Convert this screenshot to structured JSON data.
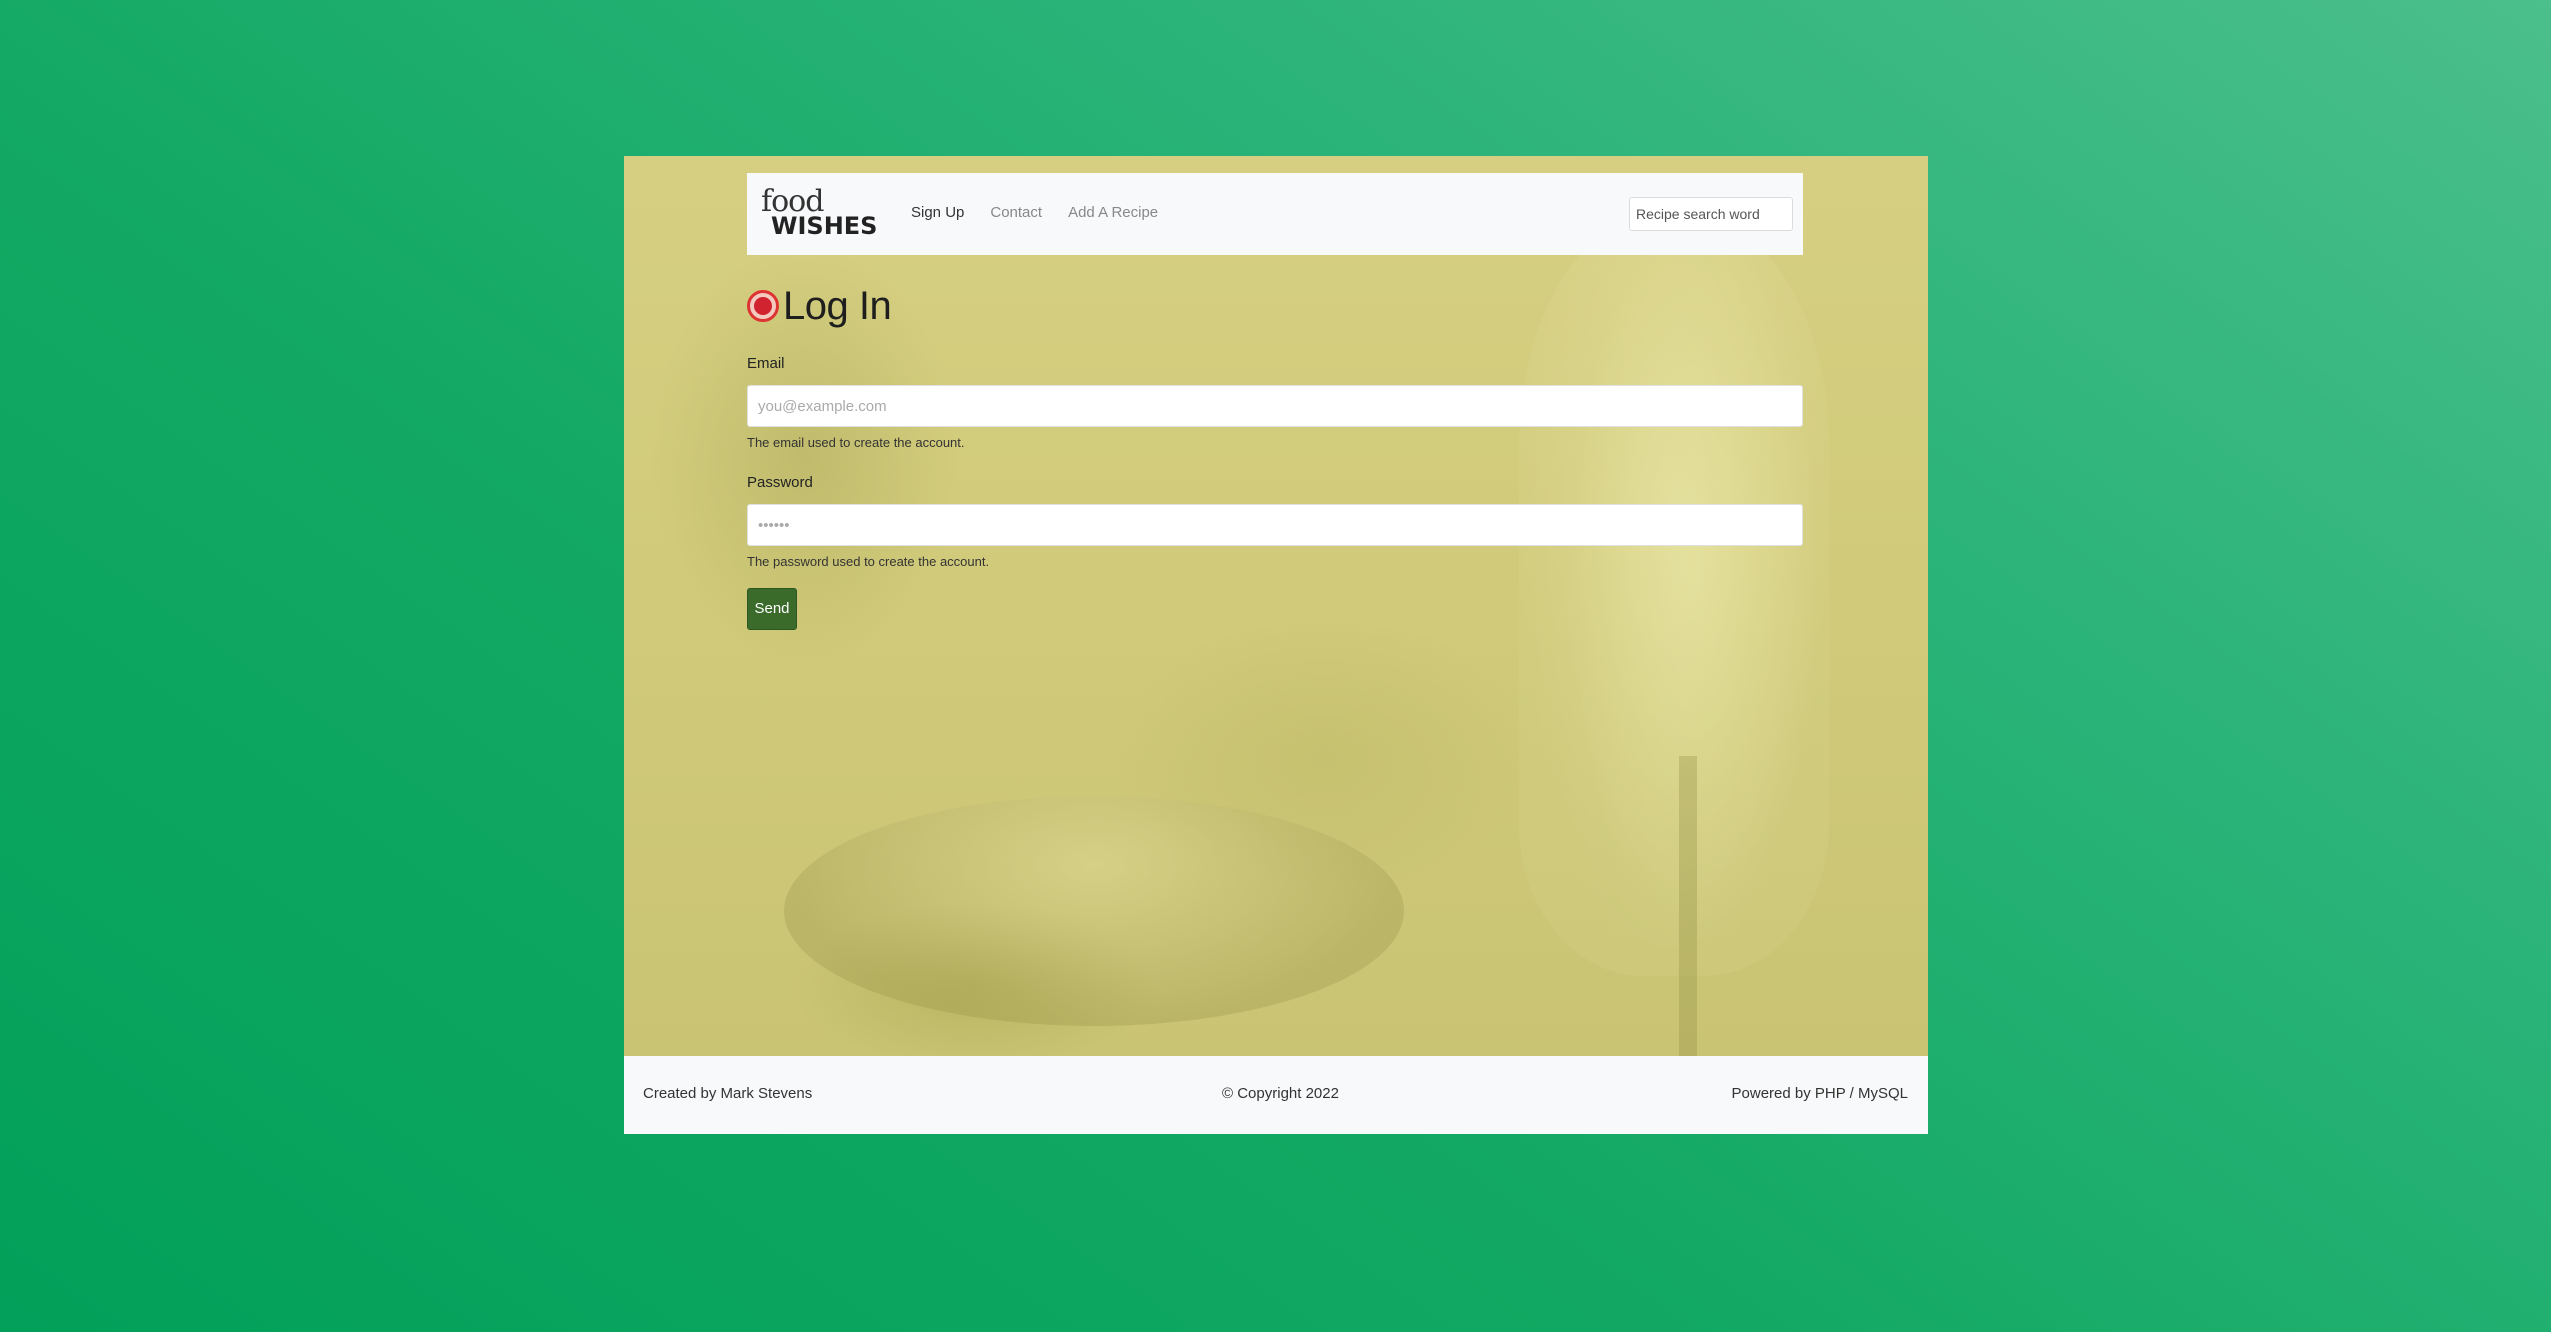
{
  "navbar": {
    "logo": {
      "line1": "food",
      "line2": "WISHES"
    },
    "links": [
      {
        "label": "Sign Up",
        "active": true
      },
      {
        "label": "Contact",
        "active": false
      },
      {
        "label": "Add A Recipe",
        "active": false
      }
    ],
    "search": {
      "placeholder": "Recipe search word",
      "value": ""
    }
  },
  "page": {
    "title": "Log In",
    "title_icon": "record-icon"
  },
  "form": {
    "email": {
      "label": "Email",
      "placeholder": "you@example.com",
      "value": "",
      "help": "The email used to create the account."
    },
    "password": {
      "label": "Password",
      "placeholder": "••••••",
      "value": "",
      "help": "The password used to create the account."
    },
    "submit_label": "Send"
  },
  "footer": {
    "left": "Created by Mark Stevens",
    "center": "© Copyright 2022",
    "right": "Powered by PHP / MySQL"
  },
  "colors": {
    "page_background": "#13a964",
    "hero_tint": "#d6cf82",
    "send_button": "#3a6b2a",
    "title_icon": "#d0232f"
  }
}
